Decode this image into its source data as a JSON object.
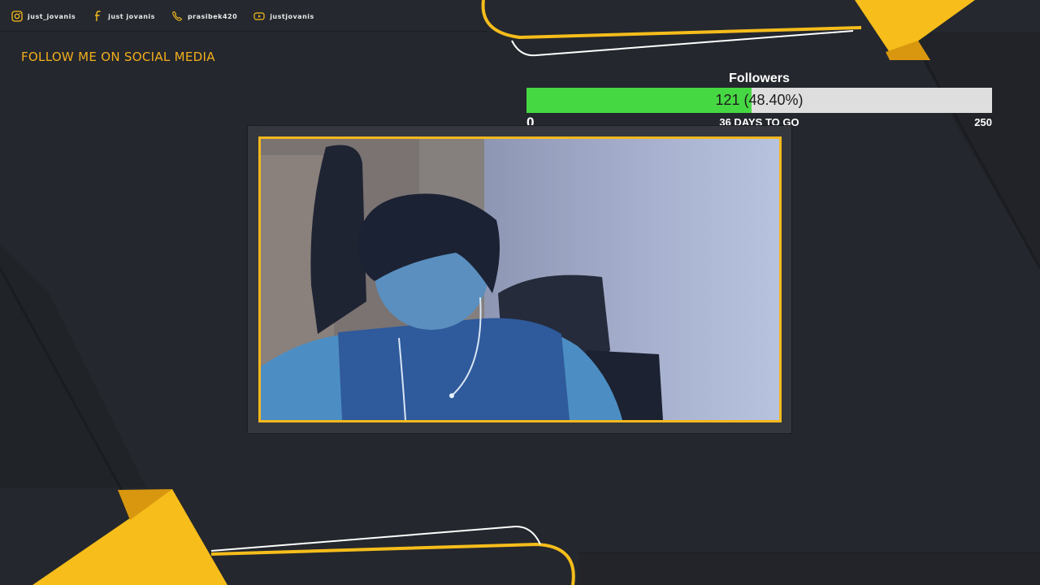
{
  "colors": {
    "background": "#24272d",
    "accent_yellow": "#f6bd1b",
    "title_orange": "#f3ae1c",
    "goal_fill": "#46d843",
    "goal_track": "#dedede",
    "webcam_border": "#f6b81c"
  },
  "social": [
    {
      "icon": "instagram-icon",
      "handle": "just_jovanis"
    },
    {
      "icon": "facebook-icon",
      "handle": "just jovanis"
    },
    {
      "icon": "phone-icon",
      "handle": "prasibek420"
    },
    {
      "icon": "youtube-icon",
      "handle": "justjovanis"
    }
  ],
  "follow_title": "FOLLOW ME ON SOCIAL MEDIA",
  "goal": {
    "title": "Followers",
    "current": 121,
    "progress_text": "121 (48.40%)",
    "percent": 48.4,
    "min": "0",
    "days_left": "36 DAYS TO GO",
    "max": "250"
  }
}
